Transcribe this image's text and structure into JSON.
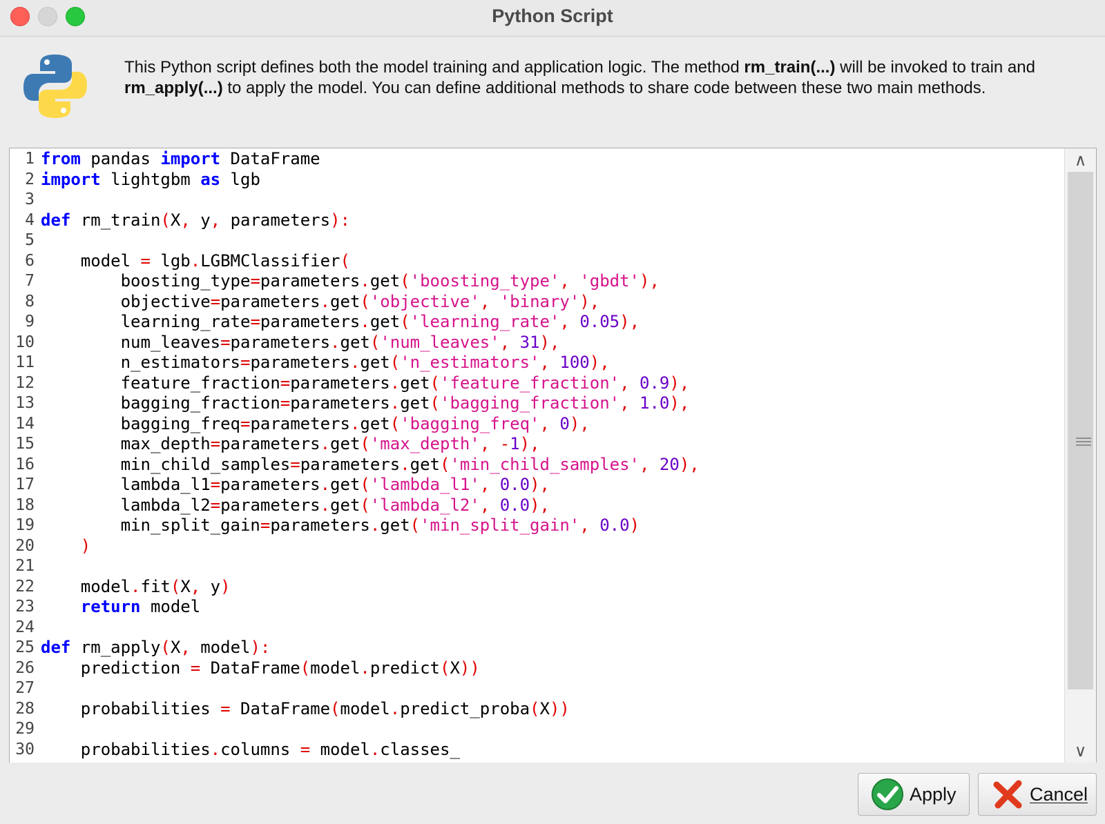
{
  "window": {
    "title": "Python Script"
  },
  "header": {
    "icon": "python-logo-icon",
    "desc_part1": "This Python script defines both the model training and application logic. The method ",
    "desc_bold1": "rm_train(...)",
    "desc_part2": " will be invoked to train and ",
    "desc_bold2": "rm_apply(...)",
    "desc_part3": " to apply the model. You can define additional methods to share code between these two main methods."
  },
  "editor": {
    "line_numbers": [
      "1",
      "2",
      "3",
      "4",
      "5",
      "6",
      "7",
      "8",
      "9",
      "10",
      "11",
      "12",
      "13",
      "14",
      "15",
      "16",
      "17",
      "18",
      "19",
      "20",
      "21",
      "22",
      "23",
      "24",
      "25",
      "26",
      "27",
      "28",
      "29",
      "30"
    ],
    "lines": [
      [
        [
          "k",
          "from"
        ],
        [
          "t",
          " pandas "
        ],
        [
          "k",
          "import"
        ],
        [
          "t",
          " DataFrame"
        ]
      ],
      [
        [
          "k",
          "import"
        ],
        [
          "t",
          " lightgbm "
        ],
        [
          "k",
          "as"
        ],
        [
          "t",
          " lgb"
        ]
      ],
      [],
      [
        [
          "k",
          "def"
        ],
        [
          "t",
          " rm_train"
        ],
        [
          "p",
          "("
        ],
        [
          "t",
          "X"
        ],
        [
          "p",
          ","
        ],
        [
          "t",
          " y"
        ],
        [
          "p",
          ","
        ],
        [
          "t",
          " parameters"
        ],
        [
          "p",
          ")"
        ],
        [
          "p",
          ":"
        ]
      ],
      [],
      [
        [
          "t",
          "    model "
        ],
        [
          "p",
          "="
        ],
        [
          "t",
          " lgb"
        ],
        [
          "p",
          "."
        ],
        [
          "t",
          "LGBMClassifier"
        ],
        [
          "p",
          "("
        ]
      ],
      [
        [
          "t",
          "        boosting_type"
        ],
        [
          "p",
          "="
        ],
        [
          "t",
          "parameters"
        ],
        [
          "p",
          "."
        ],
        [
          "t",
          "get"
        ],
        [
          "p",
          "("
        ],
        [
          "s",
          "'boosting_type'"
        ],
        [
          "p",
          ","
        ],
        [
          "t",
          " "
        ],
        [
          "s",
          "'gbdt'"
        ],
        [
          "p",
          ")"
        ],
        [
          "p",
          ","
        ]
      ],
      [
        [
          "t",
          "        objective"
        ],
        [
          "p",
          "="
        ],
        [
          "t",
          "parameters"
        ],
        [
          "p",
          "."
        ],
        [
          "t",
          "get"
        ],
        [
          "p",
          "("
        ],
        [
          "s",
          "'objective'"
        ],
        [
          "p",
          ","
        ],
        [
          "t",
          " "
        ],
        [
          "s",
          "'binary'"
        ],
        [
          "p",
          ")"
        ],
        [
          "p",
          ","
        ]
      ],
      [
        [
          "t",
          "        learning_rate"
        ],
        [
          "p",
          "="
        ],
        [
          "t",
          "parameters"
        ],
        [
          "p",
          "."
        ],
        [
          "t",
          "get"
        ],
        [
          "p",
          "("
        ],
        [
          "s",
          "'learning_rate'"
        ],
        [
          "p",
          ","
        ],
        [
          "t",
          " "
        ],
        [
          "n",
          "0.05"
        ],
        [
          "p",
          ")"
        ],
        [
          "p",
          ","
        ]
      ],
      [
        [
          "t",
          "        num_leaves"
        ],
        [
          "p",
          "="
        ],
        [
          "t",
          "parameters"
        ],
        [
          "p",
          "."
        ],
        [
          "t",
          "get"
        ],
        [
          "p",
          "("
        ],
        [
          "s",
          "'num_leaves'"
        ],
        [
          "p",
          ","
        ],
        [
          "t",
          " "
        ],
        [
          "n",
          "31"
        ],
        [
          "p",
          ")"
        ],
        [
          "p",
          ","
        ]
      ],
      [
        [
          "t",
          "        n_estimators"
        ],
        [
          "p",
          "="
        ],
        [
          "t",
          "parameters"
        ],
        [
          "p",
          "."
        ],
        [
          "t",
          "get"
        ],
        [
          "p",
          "("
        ],
        [
          "s",
          "'n_estimators'"
        ],
        [
          "p",
          ","
        ],
        [
          "t",
          " "
        ],
        [
          "n",
          "100"
        ],
        [
          "p",
          ")"
        ],
        [
          "p",
          ","
        ]
      ],
      [
        [
          "t",
          "        feature_fraction"
        ],
        [
          "p",
          "="
        ],
        [
          "t",
          "parameters"
        ],
        [
          "p",
          "."
        ],
        [
          "t",
          "get"
        ],
        [
          "p",
          "("
        ],
        [
          "s",
          "'feature_fraction'"
        ],
        [
          "p",
          ","
        ],
        [
          "t",
          " "
        ],
        [
          "n",
          "0.9"
        ],
        [
          "p",
          ")"
        ],
        [
          "p",
          ","
        ]
      ],
      [
        [
          "t",
          "        bagging_fraction"
        ],
        [
          "p",
          "="
        ],
        [
          "t",
          "parameters"
        ],
        [
          "p",
          "."
        ],
        [
          "t",
          "get"
        ],
        [
          "p",
          "("
        ],
        [
          "s",
          "'bagging_fraction'"
        ],
        [
          "p",
          ","
        ],
        [
          "t",
          " "
        ],
        [
          "n",
          "1.0"
        ],
        [
          "p",
          ")"
        ],
        [
          "p",
          ","
        ]
      ],
      [
        [
          "t",
          "        bagging_freq"
        ],
        [
          "p",
          "="
        ],
        [
          "t",
          "parameters"
        ],
        [
          "p",
          "."
        ],
        [
          "t",
          "get"
        ],
        [
          "p",
          "("
        ],
        [
          "s",
          "'bagging_freq'"
        ],
        [
          "p",
          ","
        ],
        [
          "t",
          " "
        ],
        [
          "n",
          "0"
        ],
        [
          "p",
          ")"
        ],
        [
          "p",
          ","
        ]
      ],
      [
        [
          "t",
          "        max_depth"
        ],
        [
          "p",
          "="
        ],
        [
          "t",
          "parameters"
        ],
        [
          "p",
          "."
        ],
        [
          "t",
          "get"
        ],
        [
          "p",
          "("
        ],
        [
          "s",
          "'max_depth'"
        ],
        [
          "p",
          ","
        ],
        [
          "t",
          " "
        ],
        [
          "p",
          "-"
        ],
        [
          "n",
          "1"
        ],
        [
          "p",
          ")"
        ],
        [
          "p",
          ","
        ]
      ],
      [
        [
          "t",
          "        min_child_samples"
        ],
        [
          "p",
          "="
        ],
        [
          "t",
          "parameters"
        ],
        [
          "p",
          "."
        ],
        [
          "t",
          "get"
        ],
        [
          "p",
          "("
        ],
        [
          "s",
          "'min_child_samples'"
        ],
        [
          "p",
          ","
        ],
        [
          "t",
          " "
        ],
        [
          "n",
          "20"
        ],
        [
          "p",
          ")"
        ],
        [
          "p",
          ","
        ]
      ],
      [
        [
          "t",
          "        lambda_l1"
        ],
        [
          "p",
          "="
        ],
        [
          "t",
          "parameters"
        ],
        [
          "p",
          "."
        ],
        [
          "t",
          "get"
        ],
        [
          "p",
          "("
        ],
        [
          "s",
          "'lambda_l1'"
        ],
        [
          "p",
          ","
        ],
        [
          "t",
          " "
        ],
        [
          "n",
          "0.0"
        ],
        [
          "p",
          ")"
        ],
        [
          "p",
          ","
        ]
      ],
      [
        [
          "t",
          "        lambda_l2"
        ],
        [
          "p",
          "="
        ],
        [
          "t",
          "parameters"
        ],
        [
          "p",
          "."
        ],
        [
          "t",
          "get"
        ],
        [
          "p",
          "("
        ],
        [
          "s",
          "'lambda_l2'"
        ],
        [
          "p",
          ","
        ],
        [
          "t",
          " "
        ],
        [
          "n",
          "0.0"
        ],
        [
          "p",
          ")"
        ],
        [
          "p",
          ","
        ]
      ],
      [
        [
          "t",
          "        min_split_gain"
        ],
        [
          "p",
          "="
        ],
        [
          "t",
          "parameters"
        ],
        [
          "p",
          "."
        ],
        [
          "t",
          "get"
        ],
        [
          "p",
          "("
        ],
        [
          "s",
          "'min_split_gain'"
        ],
        [
          "p",
          ","
        ],
        [
          "t",
          " "
        ],
        [
          "n",
          "0.0"
        ],
        [
          "p",
          ")"
        ]
      ],
      [
        [
          "t",
          "    "
        ],
        [
          "p",
          ")"
        ]
      ],
      [],
      [
        [
          "t",
          "    model"
        ],
        [
          "p",
          "."
        ],
        [
          "t",
          "fit"
        ],
        [
          "p",
          "("
        ],
        [
          "t",
          "X"
        ],
        [
          "p",
          ","
        ],
        [
          "t",
          " y"
        ],
        [
          "p",
          ")"
        ]
      ],
      [
        [
          "t",
          "    "
        ],
        [
          "k",
          "return"
        ],
        [
          "t",
          " model"
        ]
      ],
      [],
      [
        [
          "k",
          "def"
        ],
        [
          "t",
          " rm_apply"
        ],
        [
          "p",
          "("
        ],
        [
          "t",
          "X"
        ],
        [
          "p",
          ","
        ],
        [
          "t",
          " model"
        ],
        [
          "p",
          ")"
        ],
        [
          "p",
          ":"
        ]
      ],
      [
        [
          "t",
          "    prediction "
        ],
        [
          "p",
          "="
        ],
        [
          "t",
          " DataFrame"
        ],
        [
          "p",
          "("
        ],
        [
          "t",
          "model"
        ],
        [
          "p",
          "."
        ],
        [
          "t",
          "predict"
        ],
        [
          "p",
          "("
        ],
        [
          "t",
          "X"
        ],
        [
          "p",
          ")"
        ],
        [
          "p",
          ")"
        ]
      ],
      [],
      [
        [
          "t",
          "    probabilities "
        ],
        [
          "p",
          "="
        ],
        [
          "t",
          " DataFrame"
        ],
        [
          "p",
          "("
        ],
        [
          "t",
          "model"
        ],
        [
          "p",
          "."
        ],
        [
          "t",
          "predict_proba"
        ],
        [
          "p",
          "("
        ],
        [
          "t",
          "X"
        ],
        [
          "p",
          ")"
        ],
        [
          "p",
          ")"
        ]
      ],
      [],
      [
        [
          "t",
          "    probabilities"
        ],
        [
          "p",
          "."
        ],
        [
          "t",
          "columns "
        ],
        [
          "p",
          "="
        ],
        [
          "t",
          " model"
        ],
        [
          "p",
          "."
        ],
        [
          "t",
          "classes_"
        ]
      ]
    ]
  },
  "scrollbar": {
    "up_icon": "chevron-up-icon",
    "down_icon": "chevron-down-icon",
    "up_glyph": "∧",
    "down_glyph": "∨"
  },
  "buttons": {
    "apply_label": "Apply",
    "apply_icon": "check-icon",
    "cancel_label": "Cancel",
    "cancel_icon": "x-icon"
  },
  "colors": {
    "keyword": "#0000ff",
    "string": "#d6138b",
    "number": "#6a00c8",
    "punct": "#e00000",
    "close": "#fe5f57",
    "minimize": "#d6d6d6",
    "maximize": "#28c840"
  }
}
